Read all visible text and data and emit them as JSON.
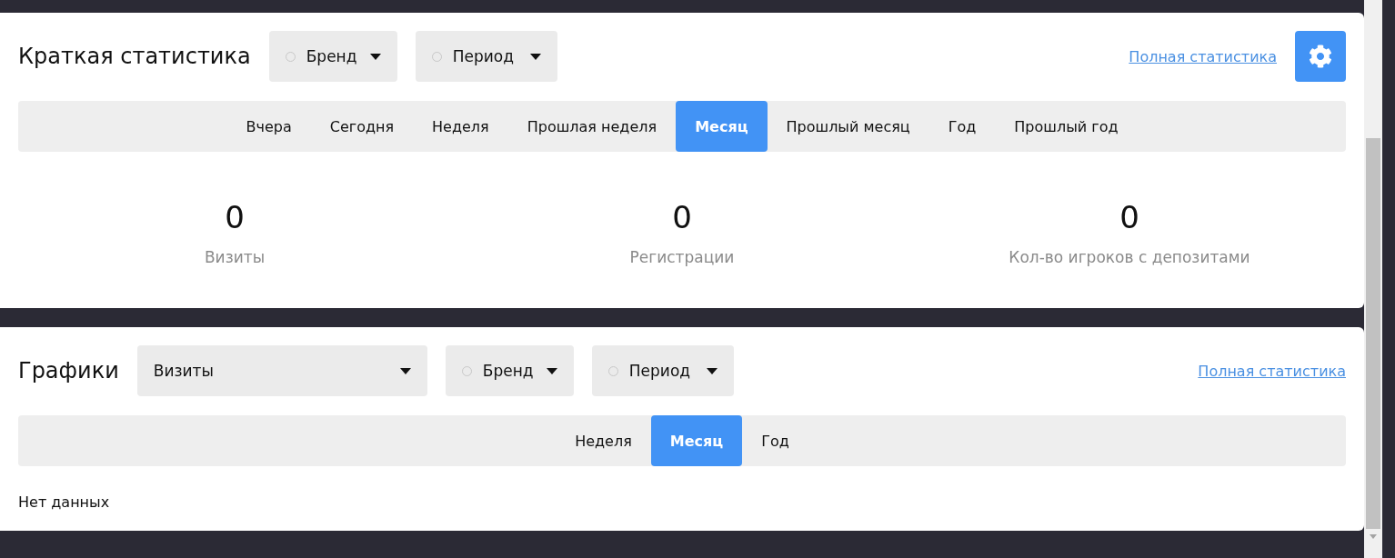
{
  "summary": {
    "title": "Краткая статистика",
    "filters": [
      {
        "label": "Бренд"
      },
      {
        "label": "Период"
      }
    ],
    "link": "Полная статистика",
    "tabs": [
      {
        "label": "Вчера",
        "selected": false
      },
      {
        "label": "Сегодня",
        "selected": false
      },
      {
        "label": "Неделя",
        "selected": false
      },
      {
        "label": "Прошлая неделя",
        "selected": false
      },
      {
        "label": "Месяц",
        "selected": true
      },
      {
        "label": "Прошлый месяц",
        "selected": false
      },
      {
        "label": "Год",
        "selected": false
      },
      {
        "label": "Прошлый год",
        "selected": false
      }
    ],
    "stats": [
      {
        "value": "0",
        "label": "Визиты"
      },
      {
        "value": "0",
        "label": "Регистрации"
      },
      {
        "value": "0",
        "label": "Кол-во игроков с депозитами"
      }
    ]
  },
  "charts": {
    "title": "Графики",
    "metric": "Визиты",
    "filters": [
      {
        "label": "Бренд"
      },
      {
        "label": "Период"
      }
    ],
    "link": "Полная статистика",
    "tabs": [
      {
        "label": "Неделя",
        "selected": false
      },
      {
        "label": "Месяц",
        "selected": true
      },
      {
        "label": "Год",
        "selected": false
      }
    ],
    "empty": "Нет данных"
  }
}
